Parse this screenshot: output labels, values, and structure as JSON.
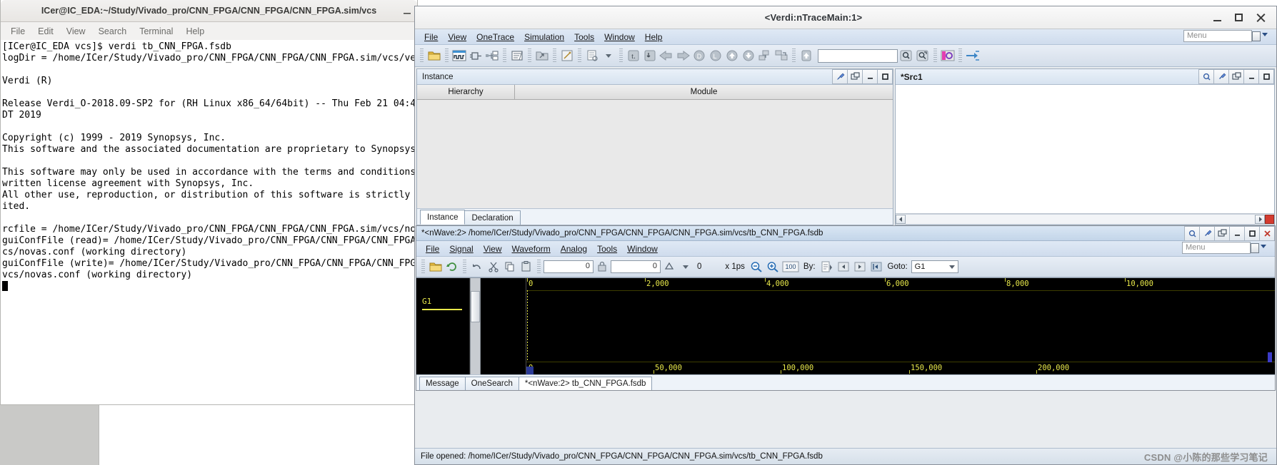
{
  "terminal": {
    "title": "ICer@IC_EDA:~/Study/Vivado_pro/CNN_FPGA/CNN_FPGA/CNN_FPGA.sim/vcs",
    "menu": [
      "File",
      "Edit",
      "View",
      "Search",
      "Terminal",
      "Help"
    ],
    "output": "[ICer@IC_EDA vcs]$ verdi tb_CNN_FPGA.fsdb\nlogDir = /home/ICer/Study/Vivado_pro/CNN_FPGA/CNN_FPGA/CNN_FPGA.sim/vcs/ve\n\nVerdi (R)\n\nRelease Verdi_O-2018.09-SP2 for (RH Linux x86_64/64bit) -- Thu Feb 21 04:4\nDT 2019\n\nCopyright (c) 1999 - 2019 Synopsys, Inc.\nThis software and the associated documentation are proprietary to Synopsys\n\nThis software may only be used in accordance with the terms and conditions\nwritten license agreement with Synopsys, Inc.\nAll other use, reproduction, or distribution of this software is strictly\nited.\n\nrcfile = /home/ICer/Study/Vivado_pro/CNN_FPGA/CNN_FPGA/CNN_FPGA.sim/vcs/no\nguiConfFile (read)= /home/ICer/Study/Vivado_pro/CNN_FPGA/CNN_FPGA/CNN_FPGA\ncs/novas.conf (working directory)\nguiConfFile (write)= /home/ICer/Study/Vivado_pro/CNN_FPGA/CNN_FPGA/CNN_FPG\nvcs/novas.conf (working directory)\n"
  },
  "verdi": {
    "title": "<Verdi:nTraceMain:1>",
    "menu": [
      "File",
      "View",
      "OneTrace",
      "Simulation",
      "Tools",
      "Window",
      "Help"
    ],
    "menu_box_placeholder": "Menu",
    "search_value": "",
    "statusbar": "File opened: /home/ICer/Study/Vivado_pro/CNN_FPGA/CNN_FPGA/CNN_FPGA.sim/vcs/tb_CNN_FPGA.fsdb",
    "watermark": "CSDN @小陈的那些学习笔记",
    "instance_panel": {
      "title": "Instance",
      "columns": [
        "Hierarchy",
        "Module"
      ],
      "rows": [],
      "tabs": [
        {
          "label": "Instance",
          "active": true
        },
        {
          "label": "Declaration",
          "active": false
        }
      ]
    },
    "src_panel": {
      "title": "*Src1",
      "content": ""
    },
    "toolbar_icons": [
      "open-file-icon",
      "waveform-icon",
      "schematic-icon",
      "flow-icon",
      "transaction-icon",
      "open-folder-icon",
      "edit-icon",
      "report-icon",
      "up-level-icon",
      "down-level-icon",
      "back-arrow-icon",
      "forward-arrow-icon",
      "driver-icon",
      "load-icon",
      "up-arrow-icon",
      "down-arrow-icon",
      "expand-icon",
      "collapse-icon",
      "top-level-icon"
    ]
  },
  "nwave": {
    "title": "*<nWave:2> /home/ICer/Study/Vivado_pro/CNN_FPGA/CNN_FPGA/CNN_FPGA.sim/vcs/tb_CNN_FPGA.fsdb",
    "menu": [
      "File",
      "Signal",
      "View",
      "Waveform",
      "Analog",
      "Tools",
      "Window"
    ],
    "menu_box_placeholder": "Menu",
    "time_value": "0",
    "delta_value": "0",
    "zero_label": "0",
    "unit_label": "x 1ps",
    "zoom_percent": "100",
    "by_label": "By:",
    "goto_label": "Goto:",
    "goto_value": "G1",
    "cursor_name": "G1",
    "ruler_top": [
      "0",
      "2,000",
      "4,000",
      "6,000",
      "8,000",
      "10,000"
    ],
    "ruler_bottom": [
      "0",
      "50,000",
      "100,000",
      "150,000",
      "200,000"
    ],
    "tabs": [
      {
        "label": "Message",
        "active": false
      },
      {
        "label": "OneSearch",
        "active": false
      },
      {
        "label": "*<nWave:2> tb_CNN_FPGA.fsdb",
        "active": true
      }
    ]
  }
}
